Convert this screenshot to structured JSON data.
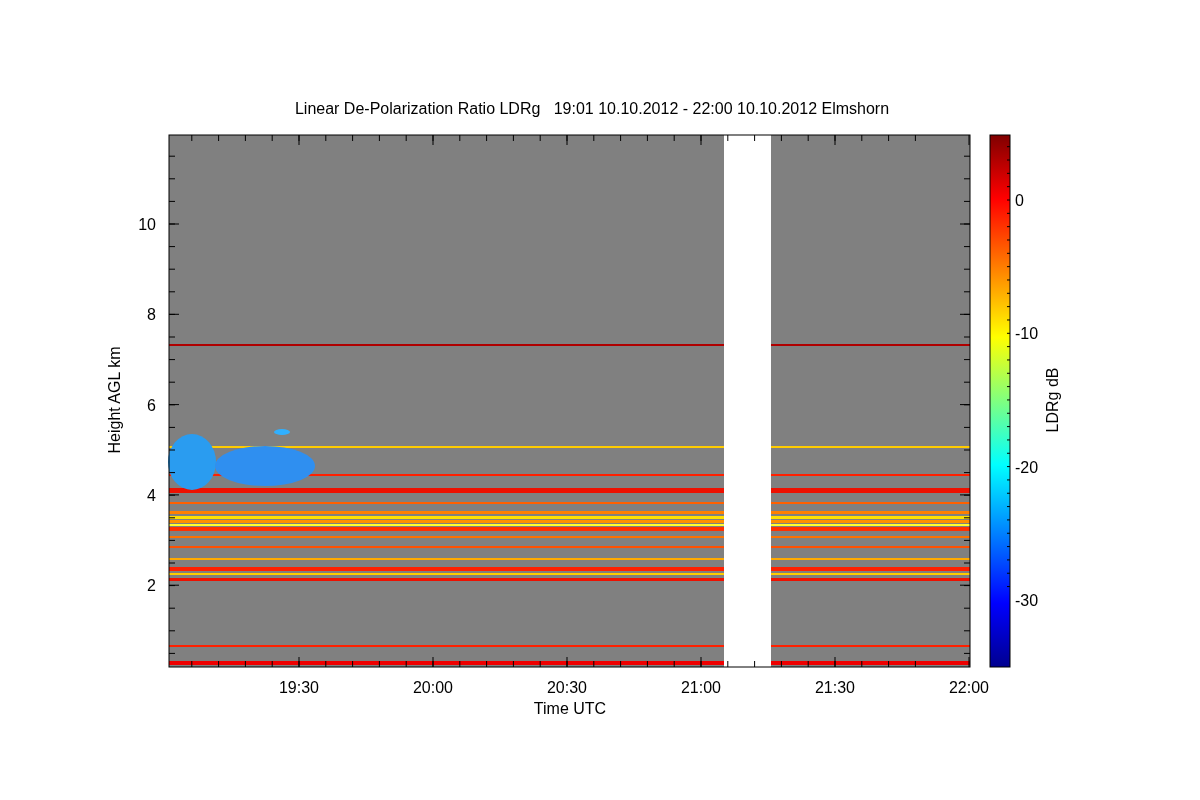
{
  "title": "Linear De-Polarization Ratio LDRg   19:01 10.10.2012 - 22:00 10.10.2012 Elmshorn",
  "x_axis": {
    "label": "Time UTC",
    "ticks": [
      "19:30",
      "20:00",
      "20:30",
      "21:00",
      "21:30",
      "22:00"
    ]
  },
  "y_axis": {
    "label": "Height AGL km",
    "ticks": [
      "10",
      "8",
      "6",
      "4",
      "2"
    ]
  },
  "colorbar": {
    "label": "LDRg dB",
    "ticks": [
      "0",
      "-10",
      "-20",
      "-30"
    ]
  }
}
